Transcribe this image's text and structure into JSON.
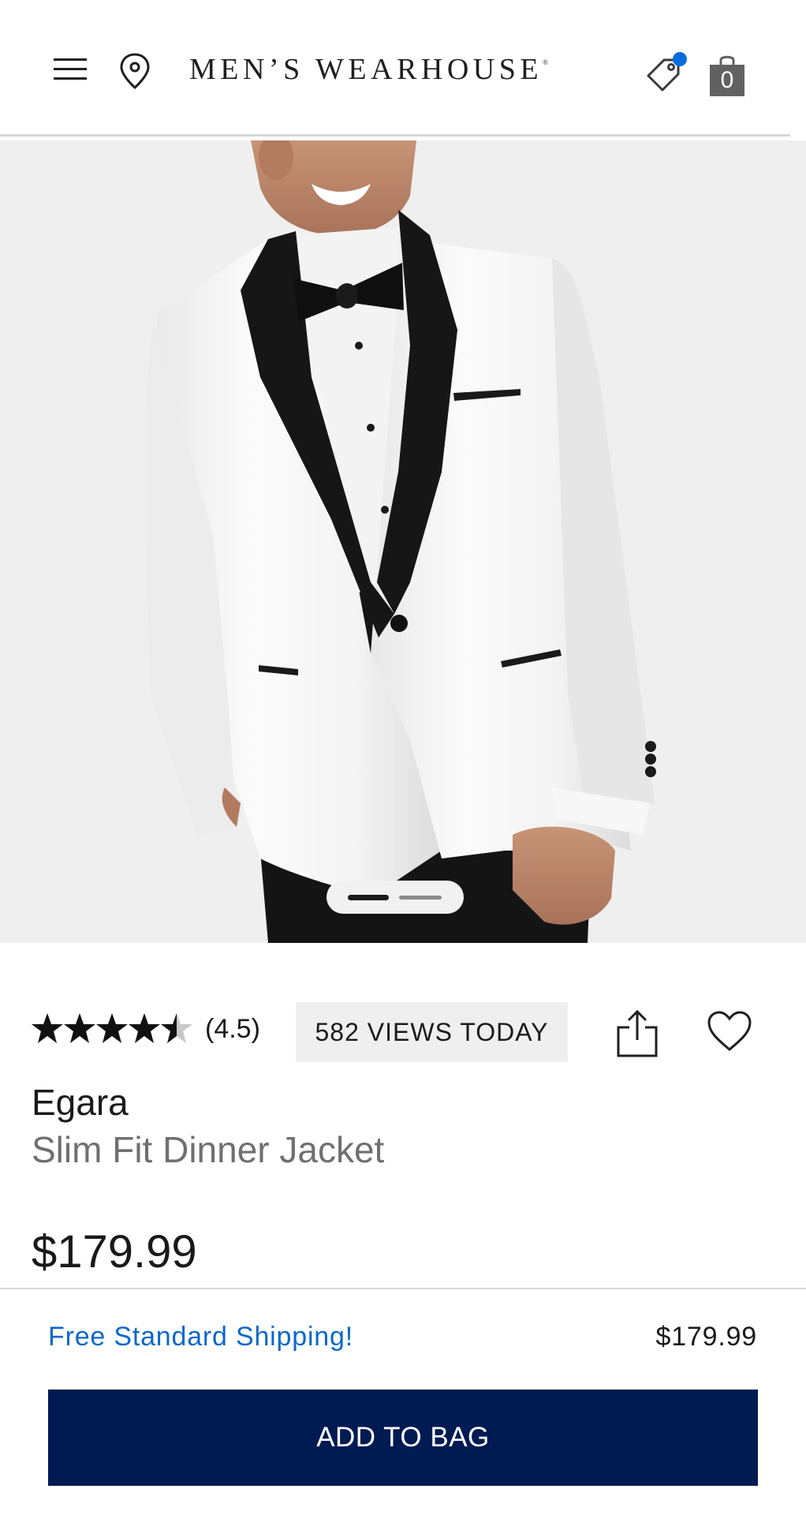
{
  "header": {
    "brand": "MEN’S WEARHOUSE",
    "brand_mark": "®",
    "icons": [
      "menu-icon",
      "location-pin-icon",
      "promo-tag-icon",
      "shopping-bag-icon"
    ],
    "bag_count": "0",
    "notification_dot_color": "#0b6bdc"
  },
  "hero": {
    "image_description": "model wearing white dinner jacket with black shawl lapel and bow tie",
    "carousel": {
      "total": 2,
      "active": 1
    }
  },
  "product": {
    "rating_stars": 4.5,
    "rating_text": "(4.5)",
    "views_text": "582 VIEWS TODAY",
    "brand": "Egara",
    "name": "Slim Fit Dinner Jacket",
    "price": "$179.99"
  },
  "sticky_bar": {
    "shipping_text": "Free Standard Shipping!",
    "price": "$179.99",
    "add_button_label": "ADD TO BAG",
    "button_color": "#001a52",
    "shipping_color": "#0a68c9"
  }
}
